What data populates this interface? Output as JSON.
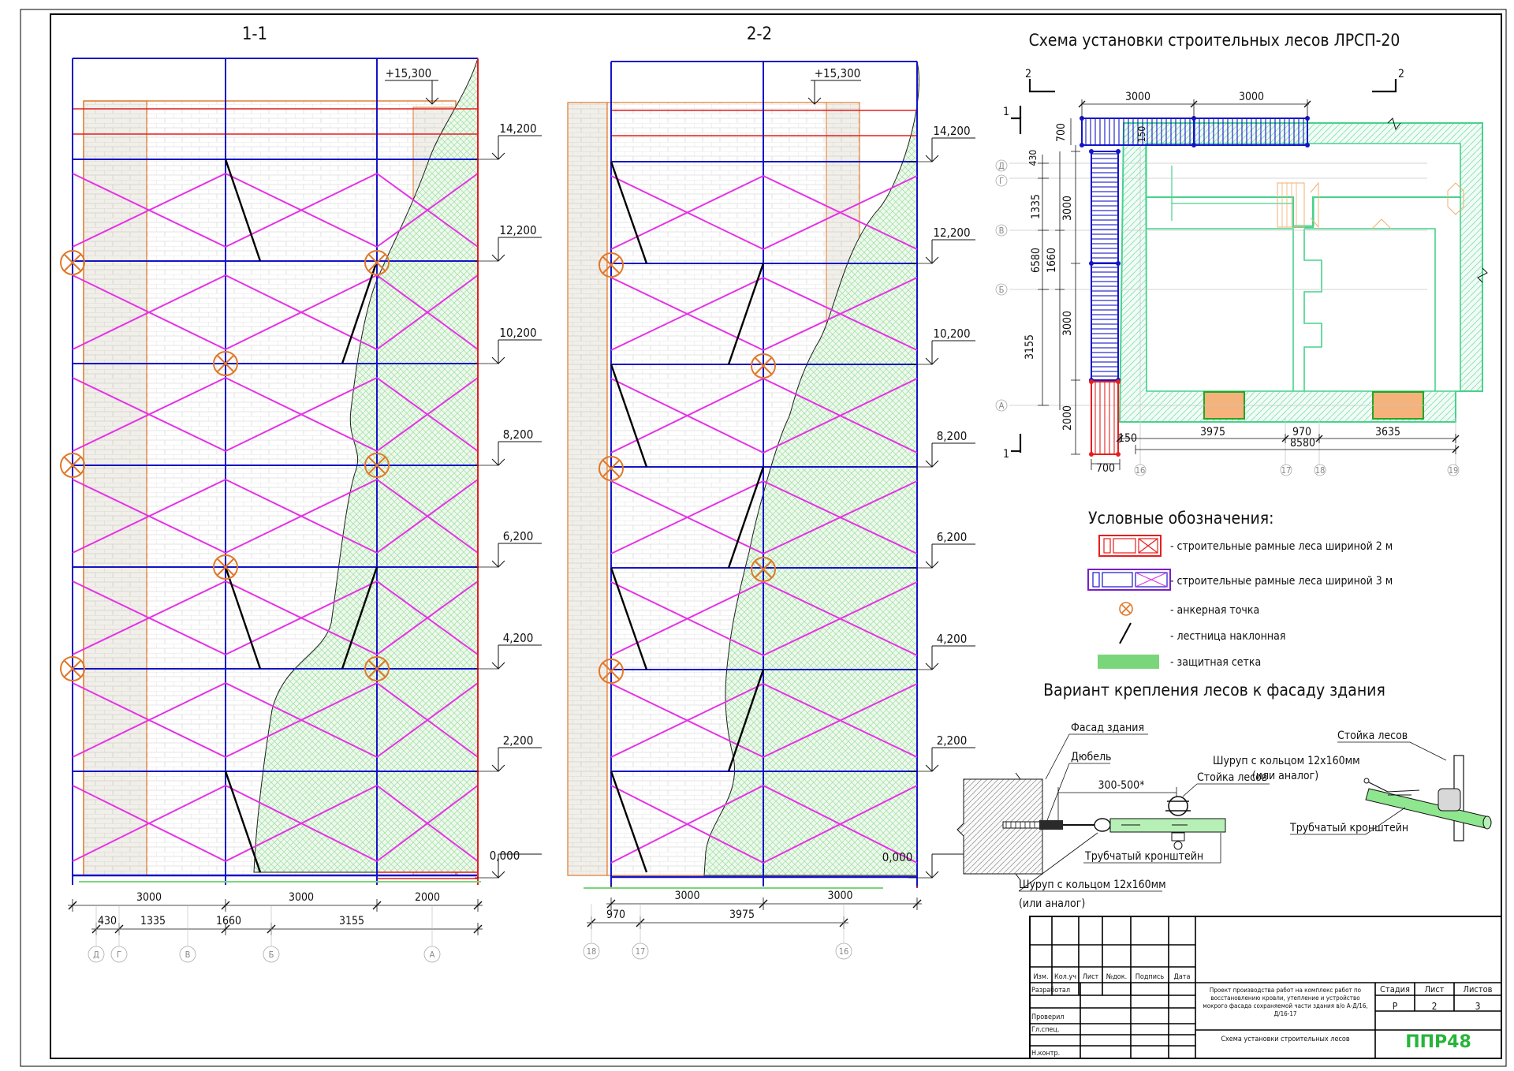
{
  "sections": {
    "s1_title": "1-1",
    "s2_title": "2-2"
  },
  "levels": [
    "14,200",
    "12,200",
    "10,200",
    "8,200",
    "6,200",
    "4,200",
    "2,200",
    "0,000"
  ],
  "top_mark": "+15,300",
  "s1_dims_top": [
    "3000",
    "3000",
    "2000"
  ],
  "s1_dims_bottom": [
    "430",
    "1335",
    "1660",
    "3155"
  ],
  "s1_axes": [
    "Д",
    "Г",
    "В",
    "Б",
    "А"
  ],
  "s2_dims_top": [
    "3000",
    "3000"
  ],
  "s2_dims_bottom": [
    "970",
    "3975"
  ],
  "s2_axes": [
    "18",
    "17",
    "16"
  ],
  "plan": {
    "title": "Схема установки строительных лесов ЛРСП-20",
    "cut_1": "1",
    "cut_2": "2",
    "dims_top": [
      "3000",
      "3000"
    ],
    "dim_700_top": "700",
    "dim_150_top": "150",
    "dim_430": "430",
    "dims_left_outer": [
      "1335",
      "1660",
      "3155"
    ],
    "dim_6580": "6580",
    "dims_left_inner": [
      "3000",
      "3000",
      "2000"
    ],
    "row_axes": [
      "Д",
      "Г",
      "В",
      "Б",
      "А"
    ],
    "dims_bottom": [
      "150",
      "3975",
      "970",
      "3635"
    ],
    "dim_8580": "8580",
    "dim_700_bottom": "700",
    "col_axes": [
      "16",
      "17",
      "18",
      "19"
    ]
  },
  "legend": {
    "title": "Условные обозначения:",
    "items": [
      "- строительные рамные леса шириной 2 м",
      "- строительные рамные леса шириной 3 м",
      "- анкерная точка",
      "- лестница наклонная",
      "- защитная сетка"
    ]
  },
  "attachment": {
    "title": "Вариант крепления лесов к фасаду здания",
    "facade": "Фасад здания",
    "dowel": "Дюбель",
    "dim": "300-500*",
    "screw_ring_top": "Шуруп с кольцом 12x160мм",
    "or_analog_top": "(или аналог)",
    "post_mid": "Стойка лесов",
    "bracket_mid": "Трубчатый кронштейн",
    "screw_ring_bottom": "Шуруп с кольцом 12x160мм",
    "or_analog_bottom": "(или аналог)",
    "post_right": "Стойка лесов",
    "bracket_right": "Трубчатый кронштейн"
  },
  "title_block": {
    "col_headers": [
      "Изм.",
      "Кол.уч",
      "Лист",
      "№док.",
      "Подпись",
      "Дата"
    ],
    "roles": [
      "Разработал",
      "Проверил",
      "Гл.спец.",
      "Н.контр."
    ],
    "project": [
      "Проект производства работ на комплекс работ по",
      "восстановлению кровли, утепление и устройство",
      "мокрого фасада сохраняемой части здания в/о А-Д/16,",
      "Д/16-17"
    ],
    "sheet_name": "Схема установки строительных лесов",
    "stage_label": "Стадия",
    "sheet_label": "Лист",
    "sheets_label": "Листов",
    "stage": "Р",
    "sheet": "2",
    "sheets": "3",
    "company": "ППР48"
  },
  "colors": {
    "frame_blue": "#1414c8",
    "brace_magenta": "#e632e6",
    "red": "#e61e1e",
    "orange": "#e0782a",
    "net_green": "#7ad67a",
    "plan_green": "#46d28c",
    "ladder": "#000000"
  }
}
